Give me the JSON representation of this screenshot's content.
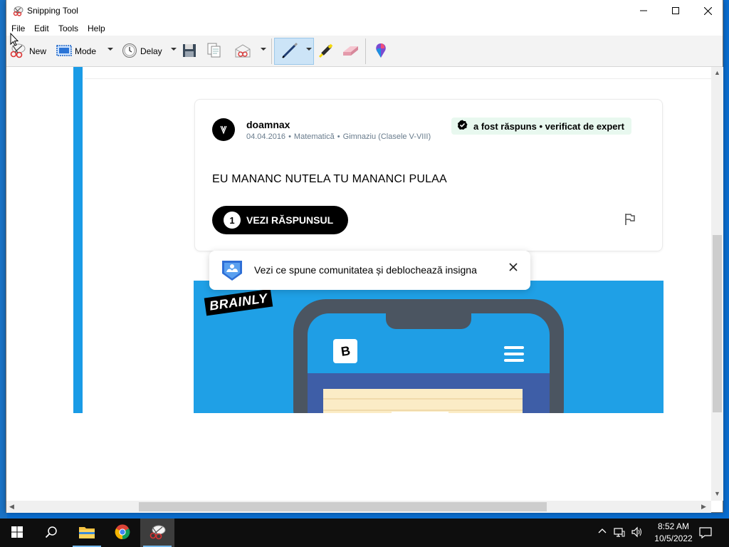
{
  "window": {
    "title": "Snipping Tool",
    "menu": [
      "File",
      "Edit",
      "Tools",
      "Help"
    ]
  },
  "toolbar": {
    "new_label": "New",
    "mode_label": "Mode",
    "delay_label": "Delay",
    "icons": [
      "scissors-icon",
      "rectangle-mode-icon",
      "clock-icon",
      "save-icon",
      "copy-icon",
      "send-snip-icon",
      "pen-icon",
      "highlighter-icon",
      "eraser-icon",
      "paint3d-icon"
    ]
  },
  "capture": {
    "post": {
      "username": "doamnax",
      "date": "04.04.2016",
      "subject": "Matematică",
      "level": "Gimnaziu (Clasele V-VIII)",
      "badge": "a fost răspuns • verificat de expert",
      "question": "EU MANANC NUTELA TU MANANCI PULAA",
      "answer_count": "1",
      "answer_button": "VEZI RĂSPUNSUL"
    },
    "toast": {
      "text": "Vezi ce spune comunitatea și deblochează insigna"
    },
    "promo": {
      "brand": "BRAINLY",
      "app_letter": "B"
    }
  },
  "taskbar": {
    "apps": [
      "start-icon",
      "search-icon",
      "file-explorer-icon",
      "chrome-icon",
      "snipping-tool-icon"
    ],
    "clock_time": "8:52 AM",
    "clock_date": "10/5/2022"
  },
  "colors": {
    "accent_blue": "#1fa0e6",
    "badge_green": "#e8f8ef",
    "check_green": "#1aaf6a",
    "taskbar": "#0e0e0e"
  }
}
